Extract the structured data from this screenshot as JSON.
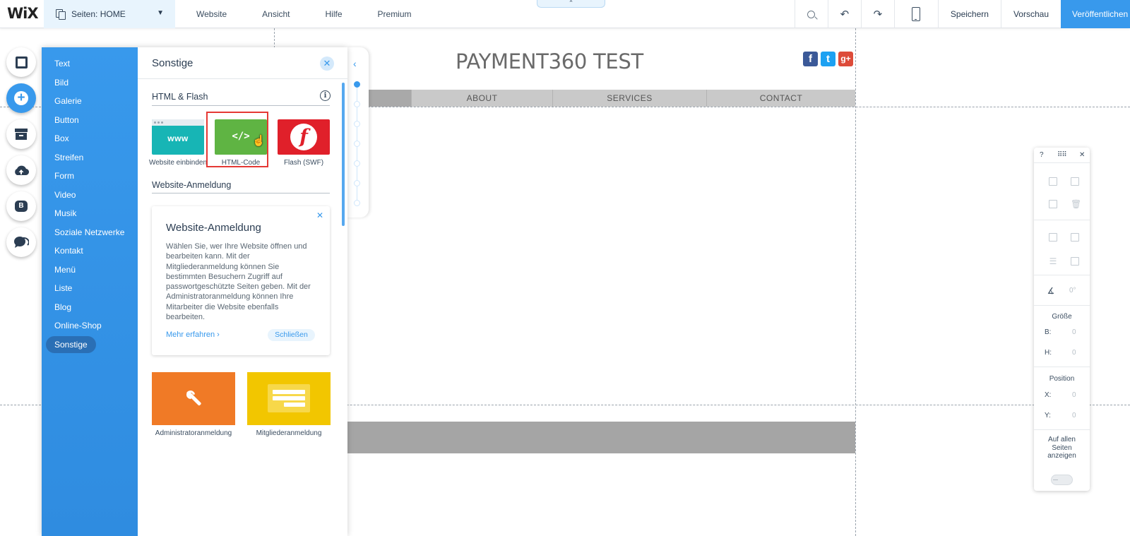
{
  "topbar": {
    "logo": "WiX",
    "pages_label": "Seiten: HOME",
    "menu": [
      "Website",
      "Ansicht",
      "Hilfe",
      "Premium"
    ],
    "save": "Speichern",
    "preview": "Vorschau",
    "publish": "Veröffentlichen"
  },
  "site": {
    "title": "PAYMENT360 TEST",
    "social": [
      "facebook",
      "twitter",
      "google-plus"
    ],
    "nav": [
      "",
      "ABOUT",
      "SERVICES",
      "CONTACT"
    ]
  },
  "tools": [
    "background-icon",
    "add-icon",
    "store-icon",
    "upload-icon",
    "blog-icon",
    "chat-icon"
  ],
  "add_panel": {
    "categories": [
      "Text",
      "Bild",
      "Galerie",
      "Button",
      "Box",
      "Streifen",
      "Form",
      "Video",
      "Musik",
      "Soziale Netzwerke",
      "Kontakt",
      "Menü",
      "Liste",
      "Blog",
      "Online-Shop",
      "Sonstige"
    ],
    "active_category": "Sonstige",
    "title": "Sonstige",
    "section_html": "HTML & Flash",
    "tiles": {
      "www_icon": "www",
      "website_embed": "Website einbinden",
      "html_icon": "</>",
      "html_code": "HTML-Code",
      "flash_icon": "f",
      "flash": "Flash (SWF)"
    },
    "section_login": "Website-Anmeldung",
    "card": {
      "title": "Website-Anmeldung",
      "text": "Wählen Sie, wer Ihre Website öffnen und bearbeiten kann. Mit der Mitgliederanmeldung können Sie bestimmten Besuchern Zugriff auf passwortgeschützte Seiten geben. Mit der Administratoranmeldung können Ihre Mitarbeiter die Website ebenfalls bearbeiten.",
      "more": "Mehr erfahren",
      "close": "Schließen"
    },
    "admin_login": "Administratoranmeldung",
    "member_login": "Mitgliederanmeldung"
  },
  "right_panel": {
    "help": "?",
    "size_label": "Größe",
    "width_label": "B:",
    "width_value": "0",
    "height_label": "H:",
    "height_value": "0",
    "position_label": "Position",
    "x_label": "X:",
    "x_value": "0",
    "y_label": "Y:",
    "y_value": "0",
    "rotation_value": "0°",
    "show_all_pages": "Auf allen Seiten anzeigen"
  },
  "colors": {
    "accent": "#3899ec",
    "html_tile": "#5fb443",
    "flash_tile": "#e0202a",
    "www_tile": "#17b5b5",
    "admin_tile": "#f07a26",
    "member_tile": "#f2c600"
  }
}
